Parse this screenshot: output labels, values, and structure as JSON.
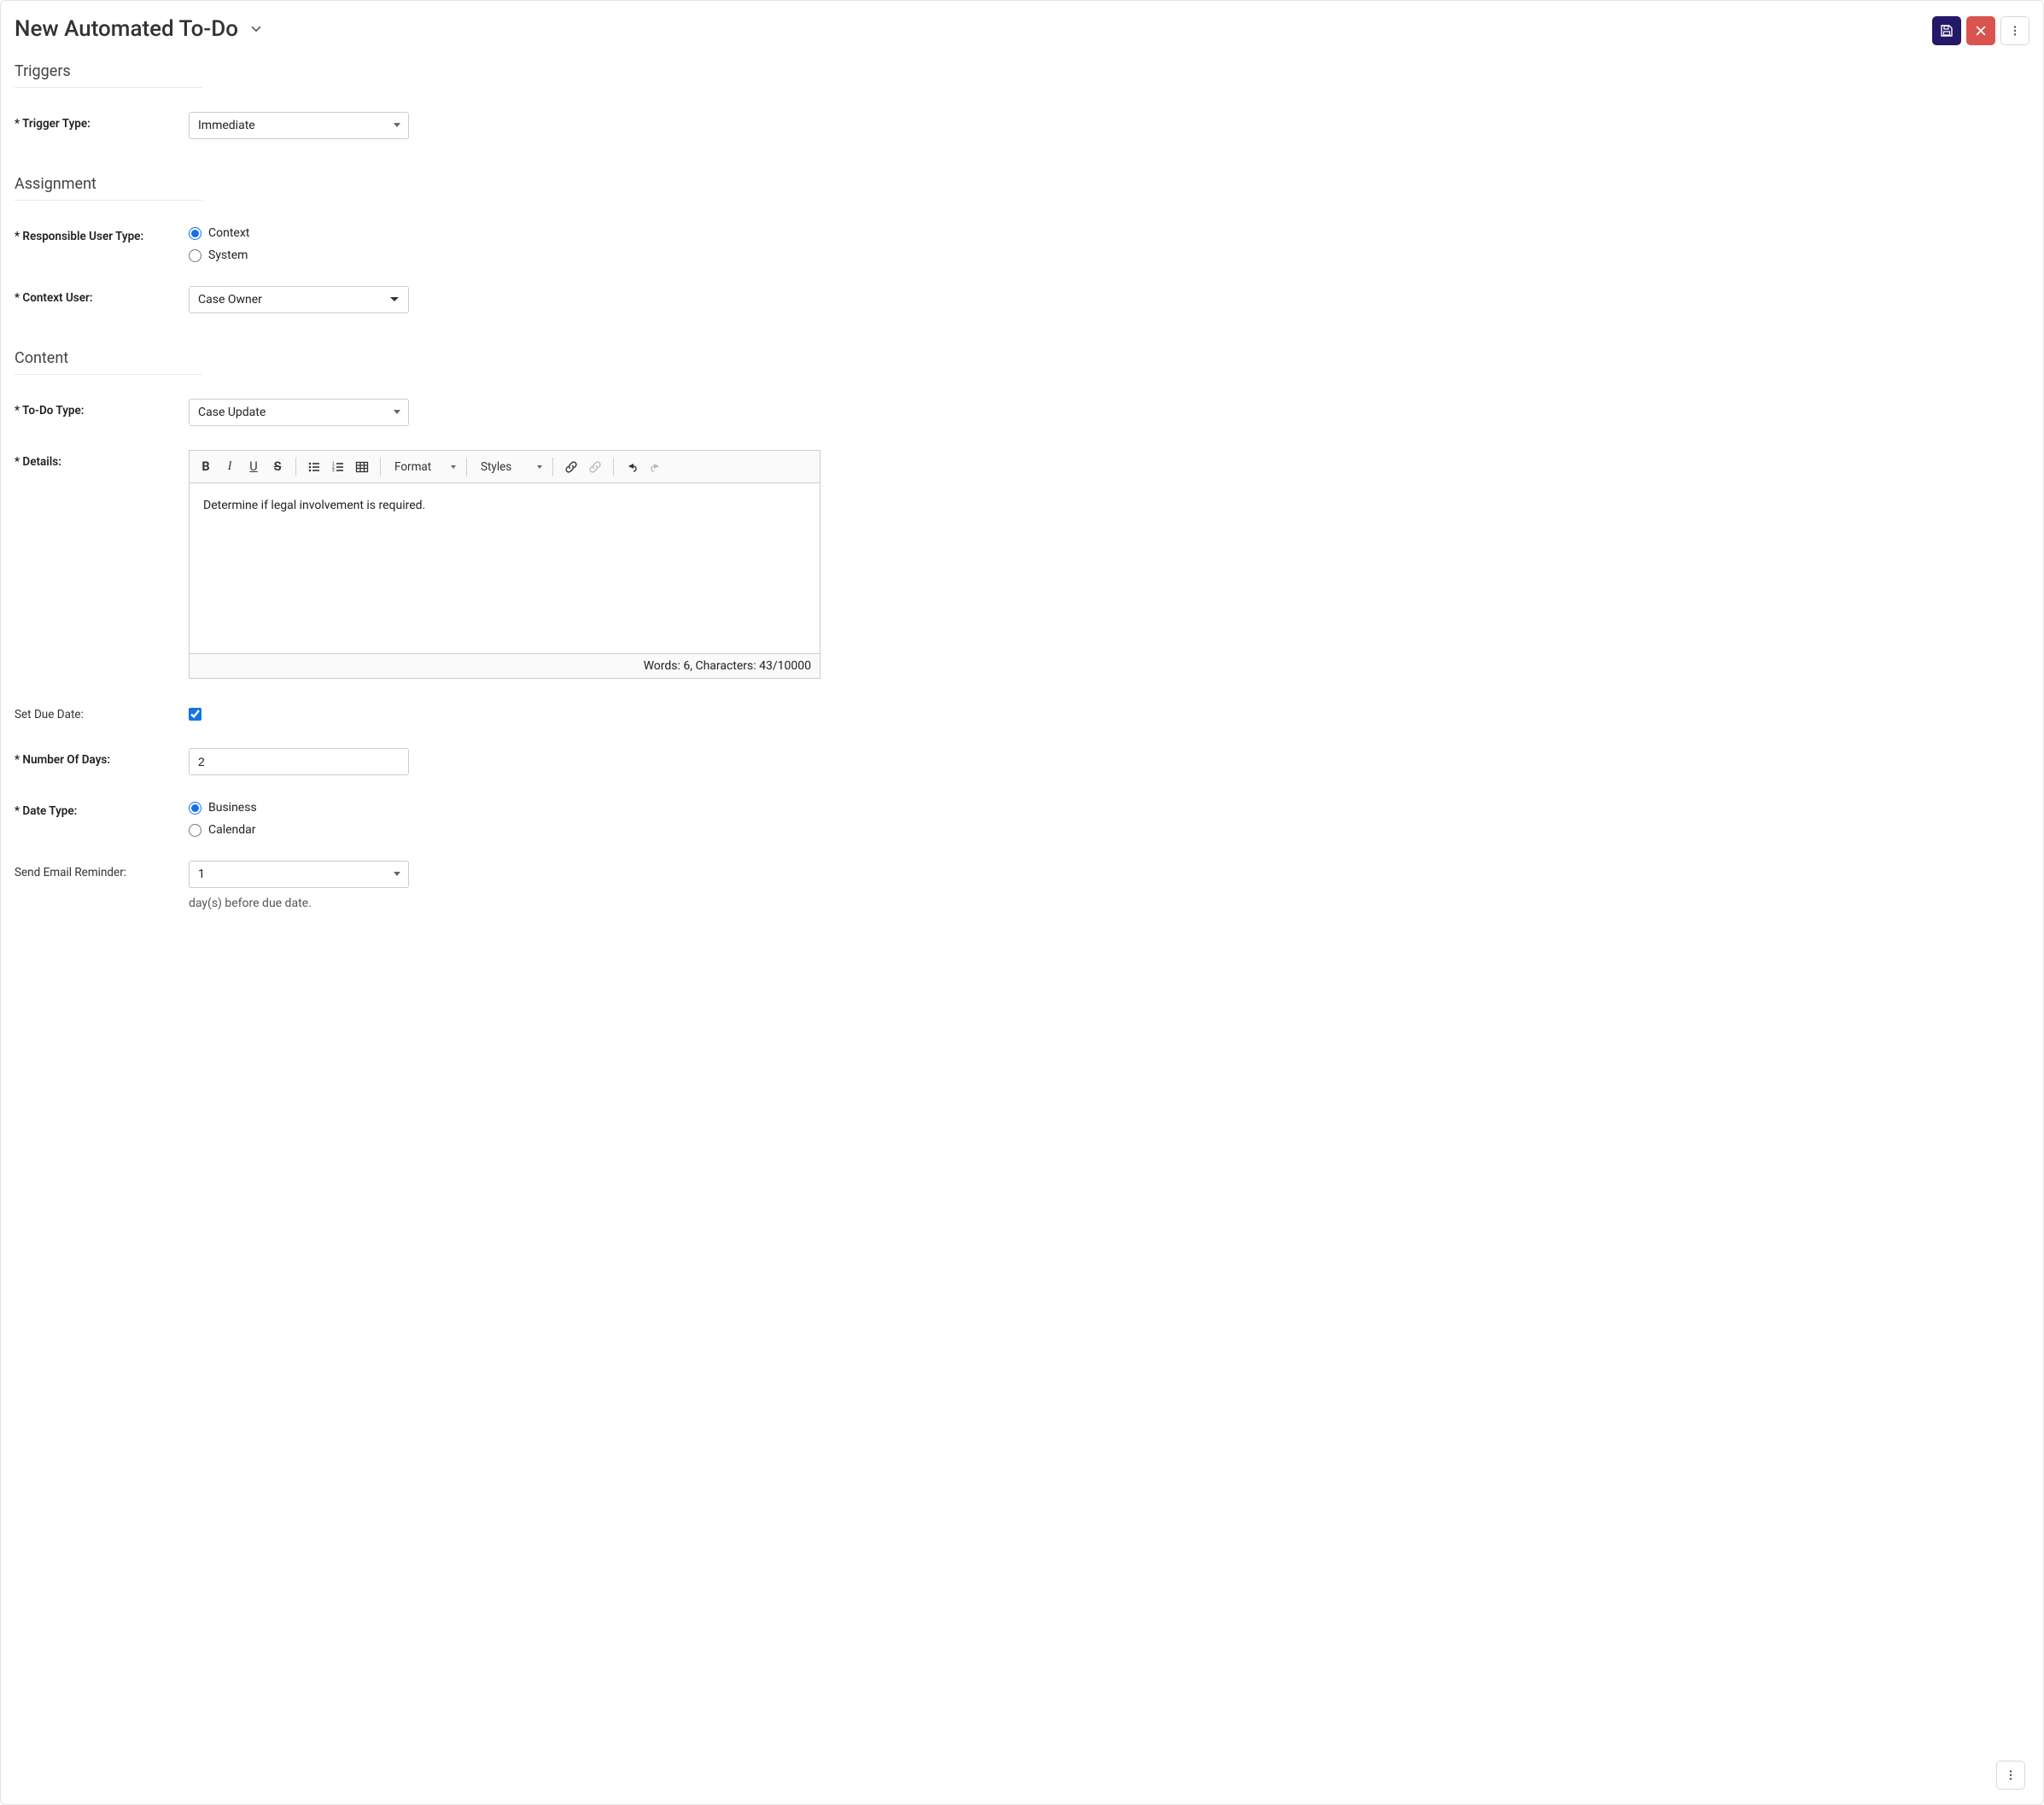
{
  "header": {
    "title": "New Automated To-Do"
  },
  "sections": {
    "triggers": "Triggers",
    "assignment": "Assignment",
    "content": "Content"
  },
  "labels": {
    "trigger_type": "* Trigger Type:",
    "responsible_user_type": "* Responsible User Type:",
    "context_user": "* Context User:",
    "todo_type": "* To-Do Type:",
    "details": "* Details:",
    "set_due_date": "Set Due Date:",
    "number_of_days": "* Number Of Days:",
    "date_type": "* Date Type:",
    "send_email_reminder": "Send Email Reminder:"
  },
  "trigger": {
    "type_value": "Immediate"
  },
  "assignment": {
    "responsible_user_type_options": {
      "context": "Context",
      "system": "System"
    },
    "responsible_user_type_selected": "context",
    "context_user_value": "Case Owner"
  },
  "content": {
    "todo_type_value": "Case Update",
    "details_text": "Determine if legal involvement is required.",
    "editor_toolbar": {
      "format_label": "Format",
      "styles_label": "Styles"
    },
    "editor_footer": "Words: 6, Characters: 43/10000",
    "set_due_date_checked": true,
    "number_of_days_value": "2",
    "date_type_options": {
      "business": "Business",
      "calendar": "Calendar"
    },
    "date_type_selected": "business",
    "send_email_reminder_value": "1",
    "reminder_helper": "day(s) before due date."
  }
}
